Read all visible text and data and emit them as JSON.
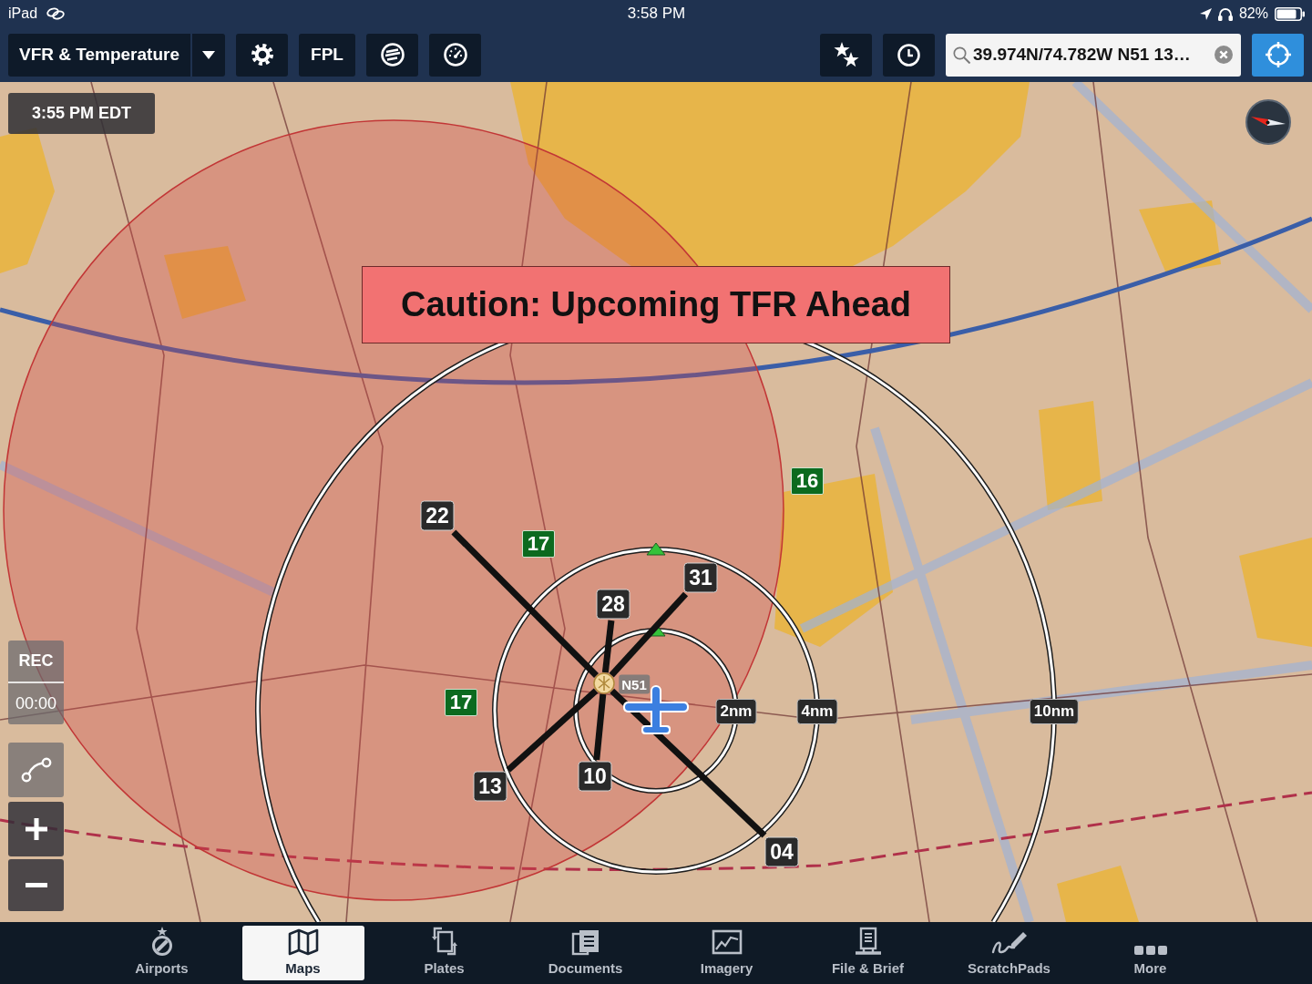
{
  "status_bar": {
    "device": "iPad",
    "time": "3:58 PM",
    "battery": "82%"
  },
  "toolbar": {
    "layer_button": "VFR & Temperature",
    "fpl_button": "FPL",
    "search": {
      "value": "39.974N/74.782W N51 13…"
    }
  },
  "map": {
    "time_badge": "3:55 PM EDT",
    "alert": "Caution: Upcoming TFR Ahead",
    "airport": {
      "label": "N51",
      "runway_ends": [
        {
          "label": "22"
        },
        {
          "label": "31"
        },
        {
          "label": "28"
        },
        {
          "label": "13"
        },
        {
          "label": "10"
        },
        {
          "label": "04"
        }
      ]
    },
    "range_rings": [
      {
        "label": "2nm"
      },
      {
        "label": "4nm"
      },
      {
        "label": "10nm"
      }
    ],
    "temperature_badges": [
      {
        "label": "17"
      },
      {
        "label": "16"
      },
      {
        "label": "17"
      }
    ],
    "recorder": {
      "label": "REC",
      "timer": "00:00"
    }
  },
  "tab_bar": [
    {
      "label": "Airports",
      "selected": false
    },
    {
      "label": "Maps",
      "selected": true
    },
    {
      "label": "Plates",
      "selected": false
    },
    {
      "label": "Documents",
      "selected": false
    },
    {
      "label": "Imagery",
      "selected": false
    },
    {
      "label": "File & Brief",
      "selected": false
    },
    {
      "label": "ScratchPads",
      "selected": false
    },
    {
      "label": "More",
      "selected": false
    }
  ]
}
